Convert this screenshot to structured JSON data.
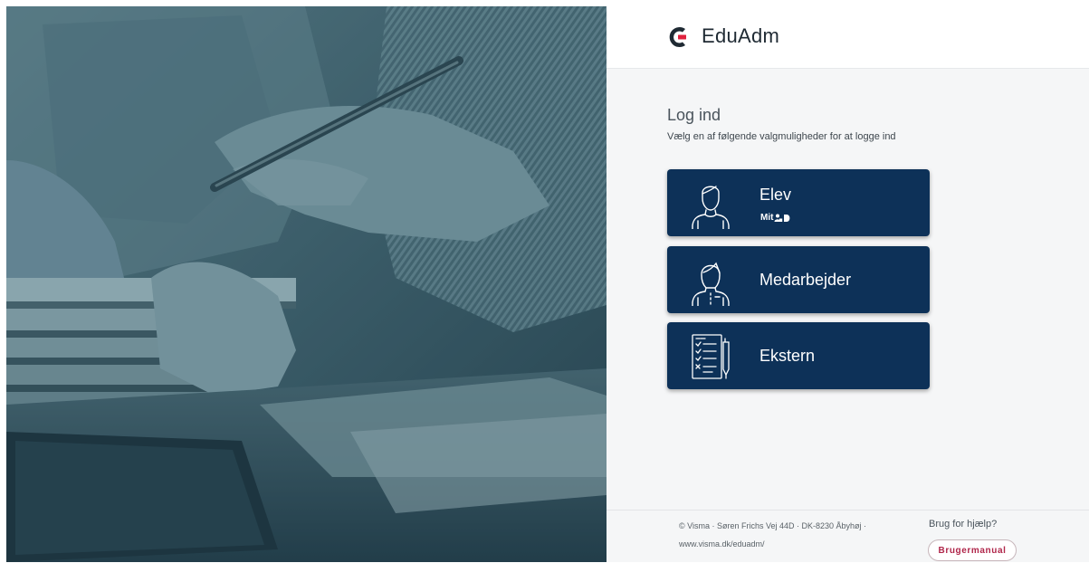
{
  "app": {
    "brand": "EduAdm",
    "brand_color": "#1f2a33",
    "accent_color": "#e0223e"
  },
  "hero": {
    "alt": "students-with-books-photo"
  },
  "login": {
    "title": "Log ind",
    "subtitle": "Vælg en af følgende valgmuligheder for at logge ind",
    "button_color": "#0d3158",
    "options": [
      {
        "label": "Elev",
        "icon": "student-icon",
        "sublabel": "Mit",
        "sublabel_logo": "mitid-logo"
      },
      {
        "label": "Medarbejder",
        "icon": "employee-icon"
      },
      {
        "label": "Ekstern",
        "icon": "checklist-document-icon"
      }
    ]
  },
  "footer": {
    "address_line1": "© Visma · Søren Frichs Vej 44D · DK-8230 Åbyhøj ·",
    "address_line2": "www.visma.dk/eduadm/",
    "help_text": "Brug for hjælp?",
    "manual_button": "Brugermanual"
  }
}
